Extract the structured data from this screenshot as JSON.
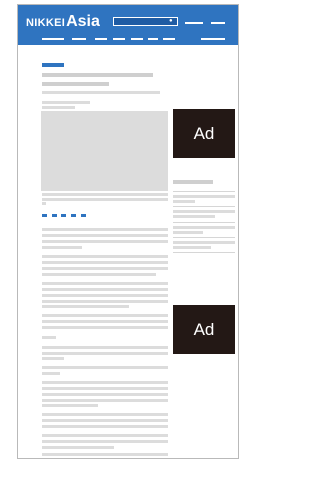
{
  "header": {
    "logo_prefix": "NIKKEI",
    "logo_suffix": "Asia",
    "search_placeholder": ""
  },
  "ads": {
    "top_label": "Ad",
    "bottom_label": "Ad"
  },
  "colors": {
    "brand_blue": "#2f74c0",
    "ad_background": "#231815",
    "placeholder_gray": "#dcdcdc"
  }
}
